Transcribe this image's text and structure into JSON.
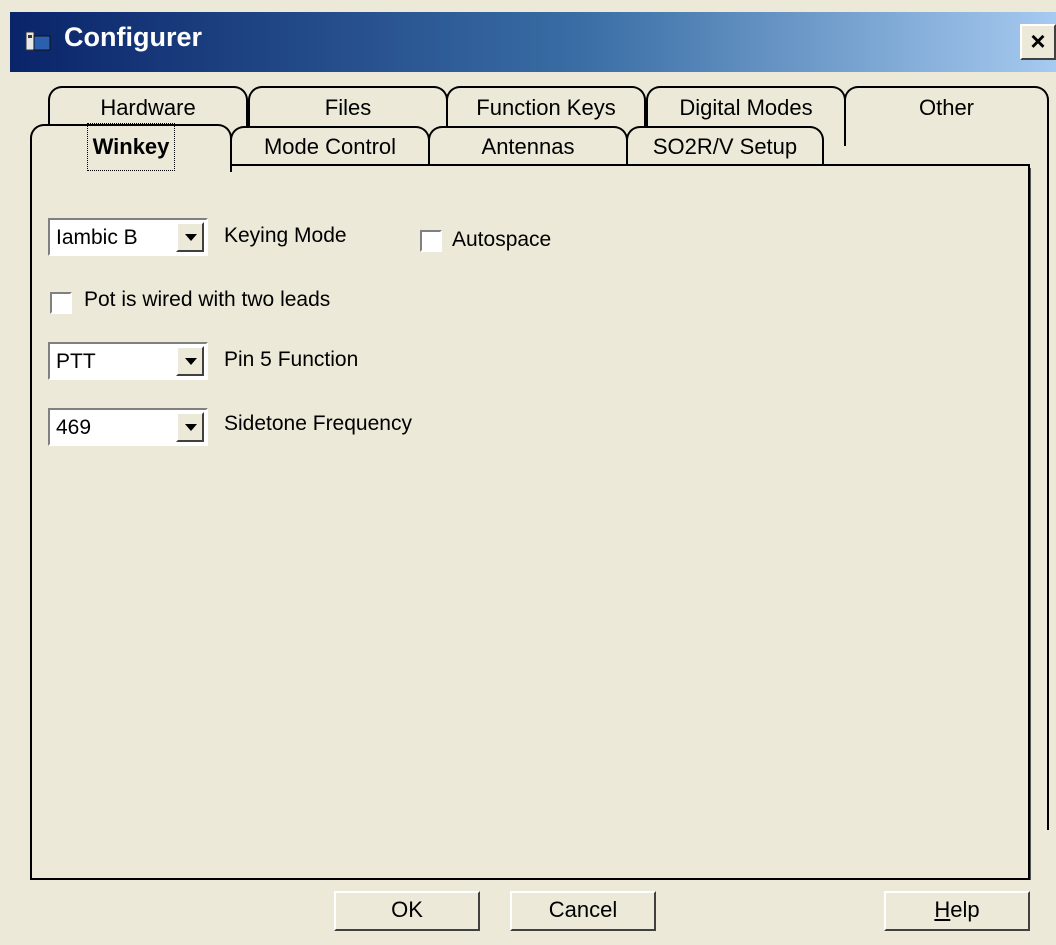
{
  "window": {
    "title": "Configurer",
    "close_label": "×"
  },
  "tabs_back": [
    "Hardware",
    "Files",
    "Function Keys",
    "Digital Modes",
    "Other"
  ],
  "tabs_front": [
    "Winkey",
    "Mode Control",
    "Antennas",
    "SO2R/V Setup"
  ],
  "active_tab": "Winkey",
  "winkey": {
    "keying_mode": {
      "value": "Iambic B",
      "label": "Keying Mode"
    },
    "autospace": {
      "label": "Autospace",
      "checked": false
    },
    "pot_two_leads": {
      "label": "Pot is wired with two leads",
      "checked": false
    },
    "pin5": {
      "value": "PTT",
      "label": "Pin 5 Function"
    },
    "sidetone": {
      "value": "469",
      "label": "Sidetone Frequency"
    }
  },
  "buttons": {
    "ok": "OK",
    "cancel": "Cancel",
    "help_prefix": "H",
    "help_rest": "elp"
  }
}
